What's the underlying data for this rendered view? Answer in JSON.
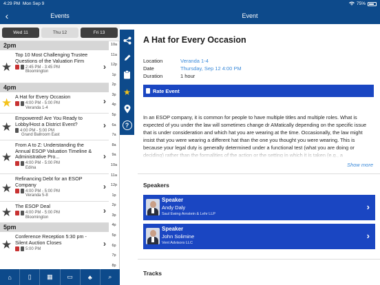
{
  "status_bar": {
    "time": "4:29 PM",
    "date": "Mon Sep 9",
    "wifi": "wifi",
    "battery": "75%",
    "battery_level": 0.75
  },
  "left_header": {
    "title": "Events",
    "back_icon": "chevron-left"
  },
  "right_header": {
    "title": "Event"
  },
  "days": [
    {
      "label": "Wed 11"
    },
    {
      "label": "Thu 12",
      "active": true
    },
    {
      "label": "Fri 13"
    }
  ],
  "sections": [
    {
      "label": "2pm"
    },
    {
      "label": "4pm"
    },
    {
      "label": "5pm"
    }
  ],
  "events": [
    {
      "title": "Top 10 Most Challenging Trustee Questions of the Valuation Firm",
      "time": "2:45 PM - 3:45 PM",
      "location": "Bloomington",
      "favorite": false
    },
    {
      "title": "A Hat for Every Occasion",
      "time": "4:00 PM - 5:00 PM",
      "location": "Veranda 1-4",
      "favorite": true
    },
    {
      "title": "Empowered! Are You Ready to Lobby/Host a District Event?",
      "time": "4:00 PM - 5:00 PM",
      "location": "Grand Ballroom East",
      "favorite": false
    },
    {
      "title": "From A to Z: Understanding the Annual ESOP Valuation Timeline & Administrative Pro...",
      "time": "4:00 PM - 5:00 PM",
      "location": "Edina",
      "favorite": false
    },
    {
      "title": "Refinancing Debt for an ESOP Company",
      "time": "4:00 PM - 5:00 PM",
      "location": "Veranda 5-8",
      "favorite": false
    },
    {
      "title": "The ESOP Deal",
      "time": "4:00 PM - 5:00 PM",
      "location": "Bloomington",
      "favorite": false
    },
    {
      "title": "Conference Reception 5:30 pm - Silent Auction Closes",
      "time": "5:00 PM",
      "location": "",
      "favorite": false
    }
  ],
  "index_letters": [
    "10a",
    "11a",
    "12p",
    "1p",
    "2p",
    "3p",
    "4p",
    "5p",
    "6a",
    "7a",
    "8a",
    "9a",
    "10a",
    "11a",
    "12p",
    "1p",
    "2p",
    "3p",
    "4p",
    "5p",
    "6p",
    "7p",
    "8p"
  ],
  "tabs": [
    {
      "icon": "home-icon",
      "glyph": "⌂"
    },
    {
      "icon": "phone-icon",
      "glyph": "▯"
    },
    {
      "icon": "grid-icon",
      "glyph": "▦"
    },
    {
      "icon": "presentation-icon",
      "glyph": "▭"
    },
    {
      "icon": "network-icon",
      "glyph": "♣"
    },
    {
      "icon": "search-icon",
      "glyph": "⌕"
    }
  ],
  "actions": [
    {
      "icon": "share-icon",
      "glyph": "⋖"
    },
    {
      "icon": "pencil-icon",
      "glyph": "✎"
    },
    {
      "icon": "clipboard-icon",
      "glyph": "▤"
    },
    {
      "icon": "star-icon",
      "glyph": "★"
    },
    {
      "icon": "map-pin-icon",
      "glyph": "⚲"
    },
    {
      "icon": "help-icon",
      "glyph": "?"
    }
  ],
  "event": {
    "title": "A Hat for Every Occasion",
    "location_label": "Location",
    "location": "Veranda 1-4",
    "date_label": "Date",
    "date": "Thursday, Sep 12 4:00 PM",
    "duration_label": "Duration",
    "duration": "1 hour",
    "rate_label": "Rate Event",
    "description": "In an ESOP company, it is common for people to have multiple titles and multiple roles. What is expected of you under the law will sometimes change dr AMatically depending on the specific issue that is under consideration and which hat you are wearing at the time. Occasionally, the law might insist that you were wearing a different hat than the one you thought you were wearing. This is because your legal duty is generally determined under a functional test (what you are doing or deciding) rather than the formalities of the action or the setting in which it is taken (e.g., a",
    "show_more": "Show more",
    "speakers_title": "Speakers",
    "speakers": [
      {
        "role": "Speaker",
        "name": "Andy Daly",
        "org": "Saul Ewing Arnstein & Lehr LLP"
      },
      {
        "role": "Speaker",
        "name": "John Solimine",
        "org": "Vent Advisors LLC"
      }
    ],
    "tracks_title": "Tracks"
  },
  "colors": {
    "nav": "#0d4a8b",
    "button": "#1a46c2",
    "link": "#3b8ad9",
    "favorite": "#f4c21b"
  }
}
